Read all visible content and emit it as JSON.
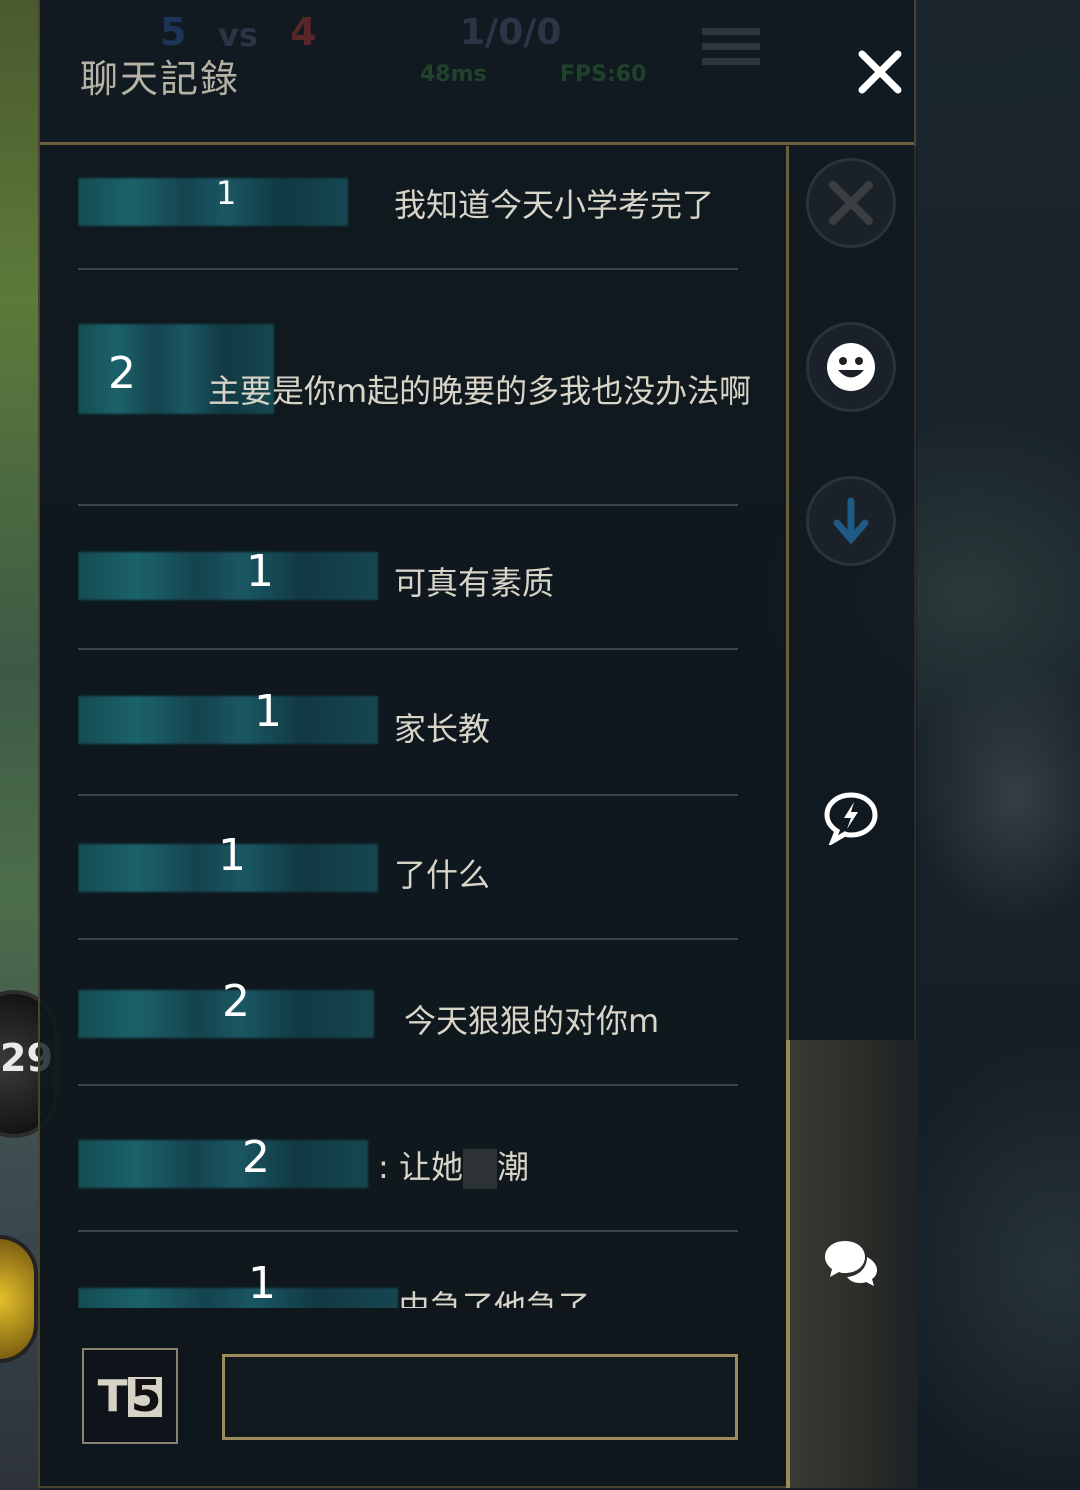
{
  "header": {
    "title": "聊天記錄",
    "close_icon": "close-icon"
  },
  "hud": {
    "blue_score": "5",
    "vs": "vs",
    "red_score": "4",
    "kda": "1/0/0",
    "ping": "48ms",
    "fps": "FPS:60"
  },
  "messages": [
    {
      "sender_num": "1",
      "text": "我知道今天小学考完了"
    },
    {
      "sender_num": "2",
      "text": "主要是你m起的晚要的多我也没办法啊"
    },
    {
      "sender_num": "1",
      "text": "可真有素质"
    },
    {
      "sender_num": "1",
      "text": "家长教"
    },
    {
      "sender_num": "1",
      "text": "了什么"
    },
    {
      "sender_num": "2",
      "text": "今天狠狠的对你m"
    },
    {
      "sender_num": "2",
      "text": ": 让她",
      "text_after": "潮"
    },
    {
      "sender_num": "1",
      "text": "由急了他急了"
    }
  ],
  "sidebar": {
    "items": [
      {
        "icon": "crossed-swords-icon"
      },
      {
        "icon": "smiley-icon"
      },
      {
        "icon": "arrow-down-icon"
      },
      {
        "icon": "quick-chat-icon"
      },
      {
        "icon": "chat-bubbles-icon"
      }
    ]
  },
  "input": {
    "mode_label_t": "T",
    "mode_label_5": "5",
    "value": "",
    "placeholder": ""
  },
  "background": {
    "level": "29"
  },
  "colors": {
    "panel_bg": "#0e161c",
    "gold_border": "#9c8a5a",
    "text": "#d8d4c8",
    "name_blur": "#1e6f78"
  }
}
